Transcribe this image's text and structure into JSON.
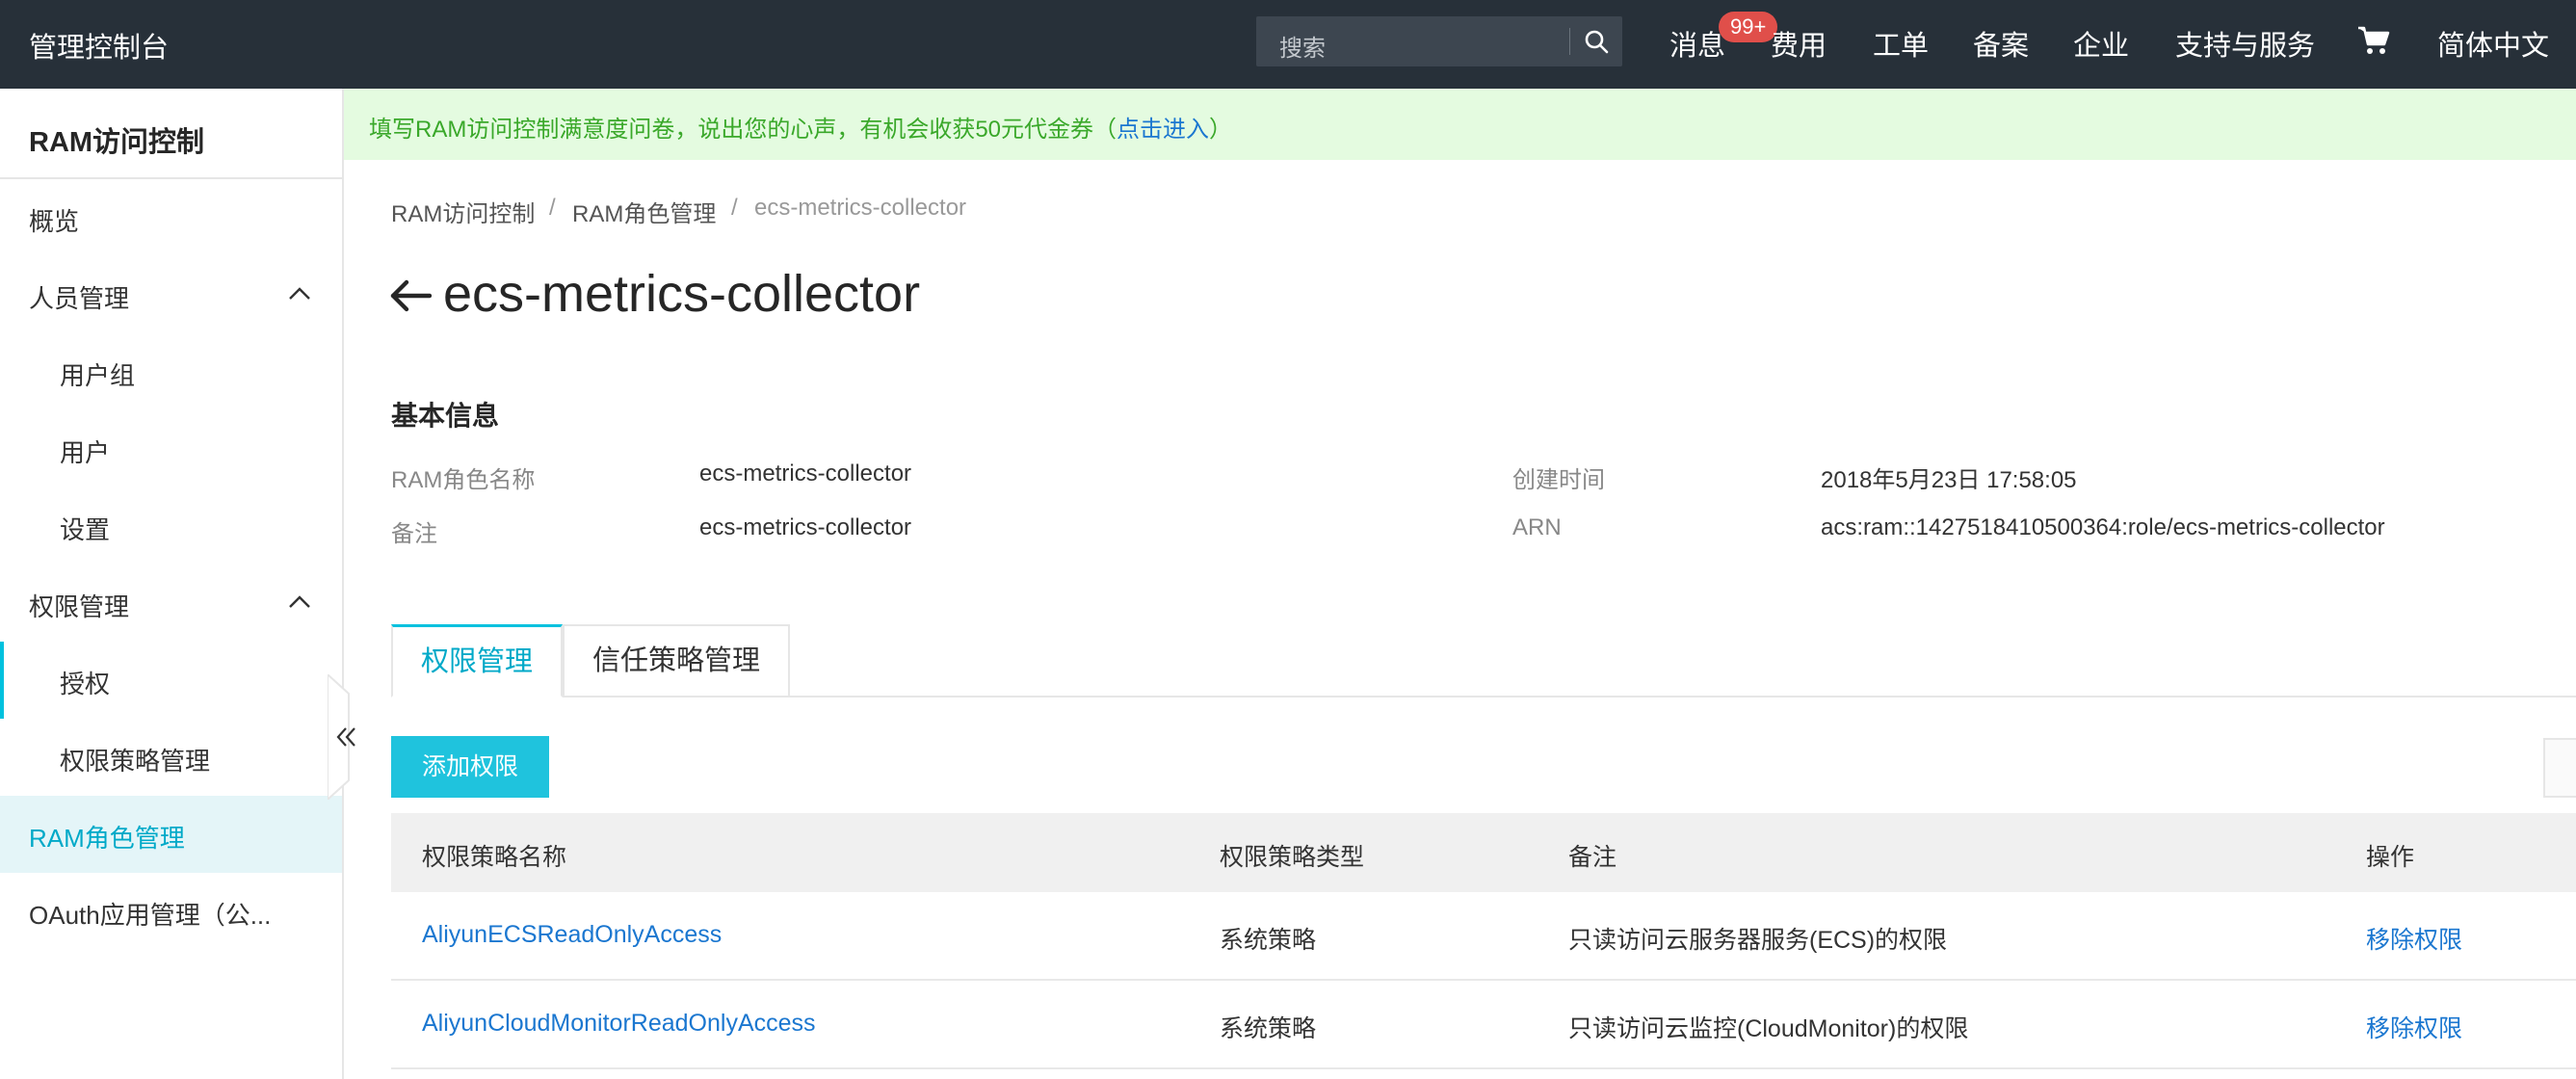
{
  "topbar": {
    "title": "管理控制台",
    "search_placeholder": "搜索",
    "nav": {
      "messages": "消息",
      "badge": "99+",
      "billing": "费用",
      "tickets": "工单",
      "icp": "备案",
      "enterprise": "企业",
      "support": "支持与服务",
      "language": "简体中文"
    }
  },
  "sidebar": {
    "header": "RAM访问控制",
    "items": [
      {
        "label": "概览"
      },
      {
        "label": "人员管理"
      },
      {
        "label": "用户组"
      },
      {
        "label": "用户"
      },
      {
        "label": "设置"
      },
      {
        "label": "权限管理"
      },
      {
        "label": "授权"
      },
      {
        "label": "权限策略管理"
      },
      {
        "label": "RAM角色管理"
      },
      {
        "label": "OAuth应用管理（公..."
      }
    ]
  },
  "notice": {
    "text": "填写RAM访问控制满意度问卷，说出您的心声，有机会收获50元代金券（",
    "link": "点击进入",
    "suffix": "）"
  },
  "breadcrumb": {
    "items": [
      "RAM访问控制",
      "RAM角色管理",
      "ecs-metrics-collector"
    ],
    "separator": "/"
  },
  "page": {
    "title": "ecs-metrics-collector"
  },
  "basic_info": {
    "title": "基本信息",
    "role_name_label": "RAM角色名称",
    "role_name": "ecs-metrics-collector",
    "note_label": "备注",
    "note": "ecs-metrics-collector",
    "created_label": "创建时间",
    "created": "2018年5月23日 17:58:05",
    "arn_label": "ARN",
    "arn": "acs:ram::1427518410500364:role/ecs-metrics-collector"
  },
  "tabs": [
    "权限管理",
    "信任策略管理"
  ],
  "add_button": "添加权限",
  "table": {
    "columns": [
      "权限策略名称",
      "权限策略类型",
      "备注",
      "操作"
    ],
    "rows": [
      {
        "name": "AliyunECSReadOnlyAccess",
        "type": "系统策略",
        "note": "只读访问云服务器服务(ECS)的权限",
        "action": "移除权限"
      },
      {
        "name": "AliyunCloudMonitorReadOnlyAccess",
        "type": "系统策略",
        "note": "只读访问云监控(CloudMonitor)的权限",
        "action": "移除权限"
      }
    ]
  }
}
